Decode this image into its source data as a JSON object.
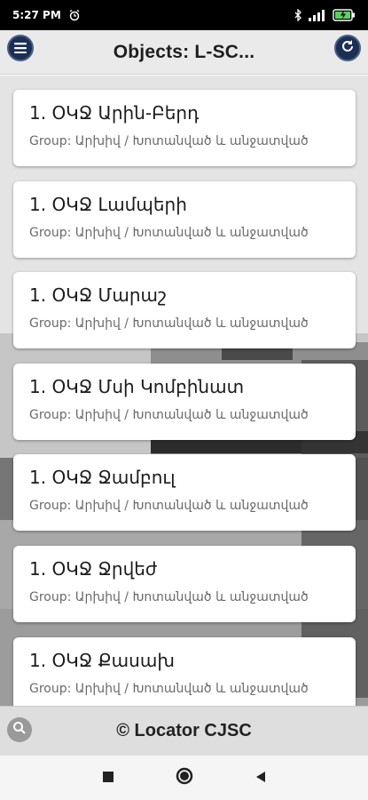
{
  "status_bar": {
    "time": "5:27 PM",
    "battery": "battery-charging-icon"
  },
  "header": {
    "title": "Objects: L-SC...",
    "menu_icon": "menu-icon",
    "refresh_icon": "refresh-icon"
  },
  "objects": [
    {
      "title": "1. ՕԿՋ Արին-Բերդ",
      "group": "Group: Արխիվ / Խոտանված և անջատված"
    },
    {
      "title": "1. ՕԿՋ Լամպերի",
      "group": "Group: Արխիվ / Խոտանված և անջատված"
    },
    {
      "title": "1. ՕԿՋ Մարաշ",
      "group": "Group: Արխիվ / Խոտանված և անջատված"
    },
    {
      "title": "1. ՕԿՋ Մսի Կոմբինատ",
      "group": "Group: Արխիվ / Խոտանված և անջատված"
    },
    {
      "title": "1. ՕԿՋ Ջամբուլ",
      "group": "Group: Արխիվ / Խոտանված և անջատված"
    },
    {
      "title": "1. ՕԿՋ Ջրվեժ",
      "group": "Group: Արխիվ / Խոտանված և անջատված"
    },
    {
      "title": "1. ՕԿՋ Քասախ",
      "group": "Group: Արխիվ / Խոտանված և անջատված"
    }
  ],
  "footer": {
    "text": "© Locator CJSC",
    "search_icon": "search-icon"
  },
  "nav_bar": {
    "recents": "square-icon",
    "home": "circle-icon",
    "back": "triangle-back-icon"
  }
}
